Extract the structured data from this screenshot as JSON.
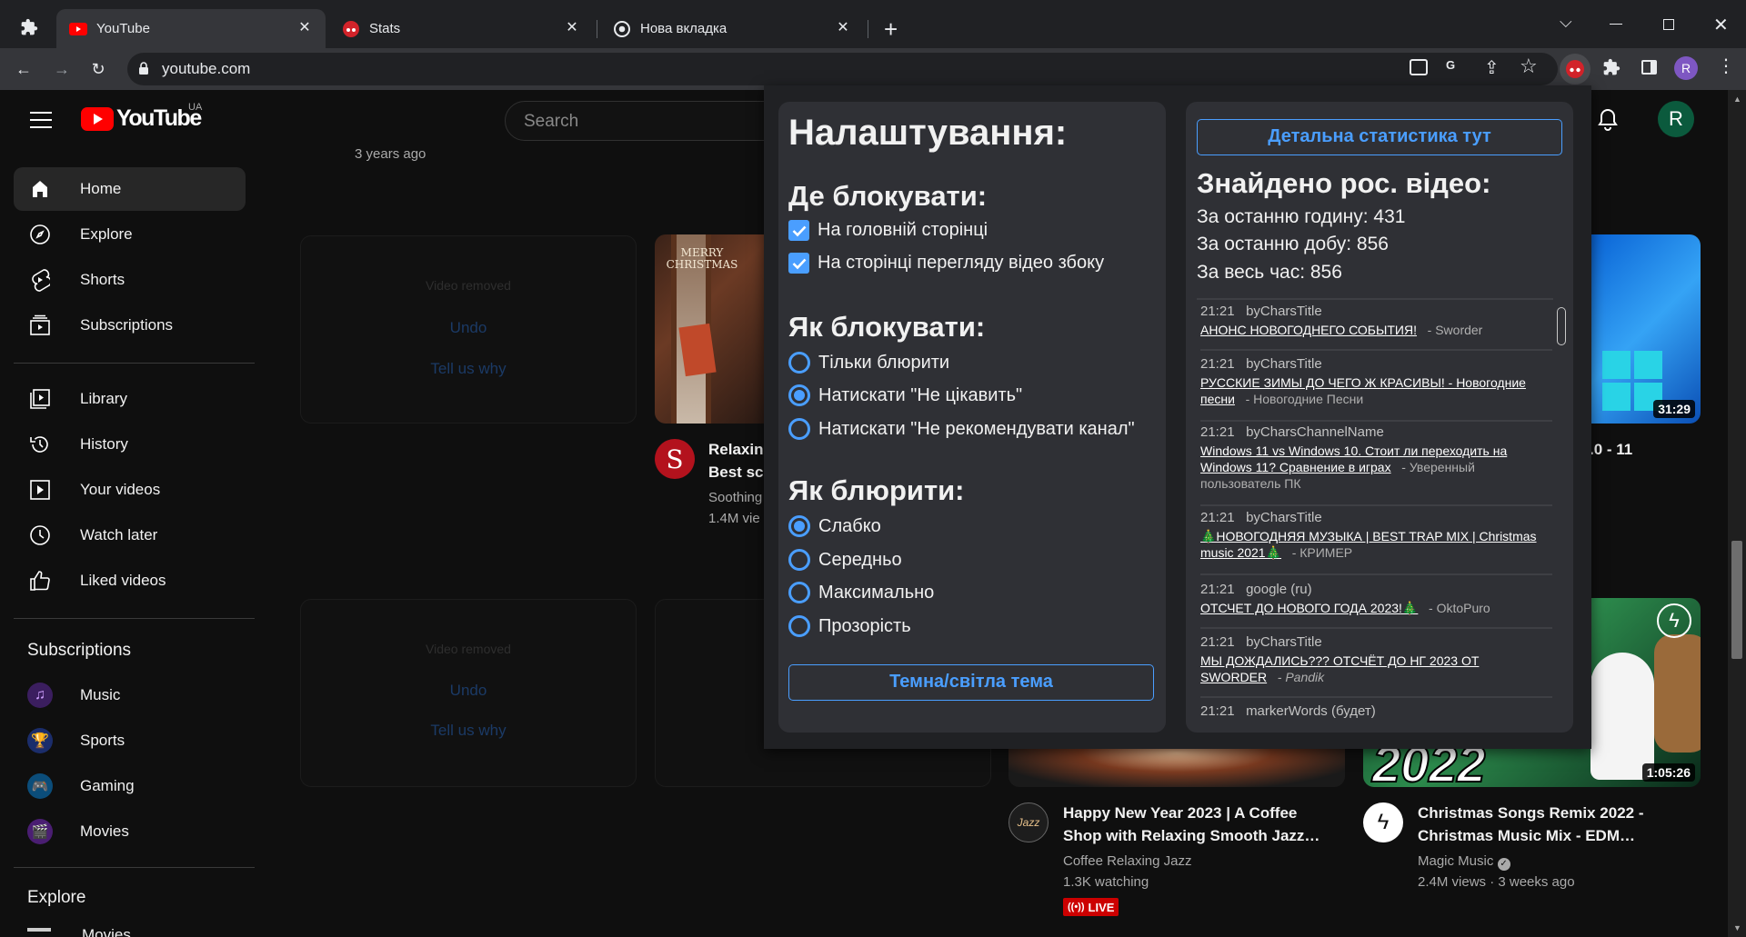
{
  "browser": {
    "tabs": [
      {
        "title": "YouTube",
        "active": true
      },
      {
        "title": "Stats",
        "active": false
      },
      {
        "title": "Нова вкладка",
        "active": false
      }
    ],
    "url": "youtube.com",
    "profile_initial": "R"
  },
  "youtube": {
    "logo_text": "YouTube",
    "region": "UA",
    "search_placeholder": "Search",
    "avatar_initial": "R",
    "old_meta": "3 years ago",
    "nav": [
      {
        "label": "Home",
        "icon": "home-icon"
      },
      {
        "label": "Explore",
        "icon": "compass-icon"
      },
      {
        "label": "Shorts",
        "icon": "shorts-icon"
      },
      {
        "label": "Subscriptions",
        "icon": "subscriptions-icon"
      }
    ],
    "nav2": [
      {
        "label": "Library",
        "icon": "library-icon"
      },
      {
        "label": "History",
        "icon": "history-icon"
      },
      {
        "label": "Your videos",
        "icon": "your-videos-icon"
      },
      {
        "label": "Watch later",
        "icon": "clock-icon"
      },
      {
        "label": "Liked videos",
        "icon": "thumbs-up-icon"
      }
    ],
    "subs_heading": "Subscriptions",
    "subs": [
      {
        "label": "Music",
        "color": "#3b1e5f"
      },
      {
        "label": "Sports",
        "color": "#1b2d6b"
      },
      {
        "label": "Gaming",
        "color": "#0b4d7a"
      },
      {
        "label": "Movies",
        "color": "#4a1e72"
      }
    ],
    "explore_heading": "Explore",
    "explore_partial": "Movies",
    "removed": {
      "text": "Video removed",
      "undo": "Undo",
      "why": "Tell us why"
    },
    "videos": [
      {
        "title_line1": "Relaxin",
        "title_line2": "Best sc",
        "channel": "Soothing",
        "meta": "1.4M vie"
      },
      {
        "partial_title": ".0 - 11",
        "duration": "31:29"
      },
      {
        "title_line1": "Happy New Year 2023 | A Coffee",
        "title_line2": "Shop with Relaxing Smooth Jazz…",
        "channel": "Coffee Relaxing Jazz",
        "meta": "1.3K watching",
        "badge": "LIVE"
      },
      {
        "title_line1": "Christmas Songs Remix 2022 -",
        "title_line2": "Christmas Music Mix - EDM…",
        "channel": "Magic Music",
        "meta": "2.4M views · 3 weeks ago",
        "duration": "1:05:26",
        "thumb_text": "2022"
      }
    ],
    "thumb_christmas_text": "MERRY CHRISTMAS"
  },
  "popup": {
    "settings": {
      "title": "Налаштування:",
      "where_heading": "Де блокувати:",
      "where_options": [
        {
          "label": "На головній сторінці",
          "checked": true
        },
        {
          "label": "На сторінці перегляду відео збоку",
          "checked": true
        }
      ],
      "how_heading": "Як блокувати:",
      "how_options": [
        {
          "label": "Тільки блюрити",
          "selected": false
        },
        {
          "label": "Натискати \"Не цікавить\"",
          "selected": true
        },
        {
          "label": "Натискати \"Не рекомендувати канал\"",
          "selected": false
        }
      ],
      "blur_heading": "Як блюрити:",
      "blur_options": [
        {
          "label": "Слабко",
          "selected": true
        },
        {
          "label": "Середньо",
          "selected": false
        },
        {
          "label": "Максимально",
          "selected": false
        },
        {
          "label": "Прозорість",
          "selected": false
        }
      ],
      "theme_button": "Темна/світла тема"
    },
    "stats": {
      "detail_button": "Детальна статистика тут",
      "heading": "Знайдено рос. відео:",
      "last_hour": "За останню годину: 431",
      "last_day": "За останню добу: 856",
      "all_time": "За весь час: 856",
      "entries": [
        {
          "time": "21:21",
          "marker": "byCharsTitle",
          "title": "АНОНС НОВОГОДНЕГО СОБЫТИЯ!",
          "channel": "- Sworder"
        },
        {
          "time": "21:21",
          "marker": "byCharsTitle",
          "title": "РУССКИЕ ЗИМЫ ДО ЧЕГО Ж КРАСИВЫ! - Новогодние песни",
          "channel": "- Новогодние Песни"
        },
        {
          "time": "21:21",
          "marker": "byCharsChannelName",
          "title": "Windows 11 vs Windows 10. Стоит ли переходить на Windows 11? Сравнение в играх",
          "channel": "- Уверенный пользователь ПК"
        },
        {
          "time": "21:21",
          "marker": "byCharsTitle",
          "title": "🎄НОВОГОДНЯЯ МУЗЫКА | BEST TRAP MIX | Christmas music 2021🎄",
          "channel": "- КРИМЕР"
        },
        {
          "time": "21:21",
          "marker": "google (ru)",
          "title": "ОТСЧЕТ ДО НОВОГО ГОДА 2023!🎄",
          "channel": "- OktoPuro"
        },
        {
          "time": "21:21",
          "marker": "byCharsTitle",
          "title": "МЫ ДОЖДАЛИСЬ??? ОТСЧЁТ ДО НГ 2023 ОТ SWORDER",
          "channel": "- Pandik"
        },
        {
          "time": "21:21",
          "marker": "markerWords (будет)",
          "title": "",
          "channel": ""
        }
      ]
    }
  }
}
